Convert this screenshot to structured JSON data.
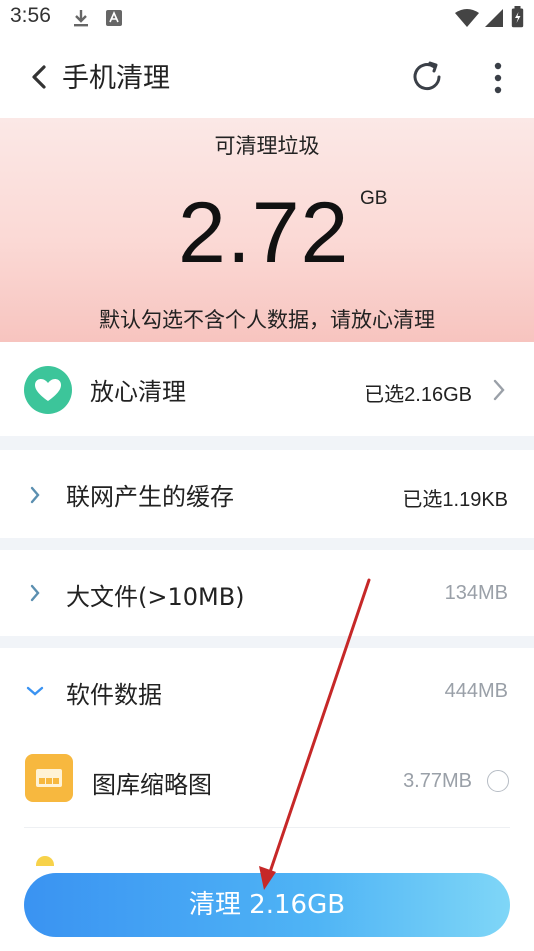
{
  "status_bar": {
    "time": "3:56",
    "icons": [
      "download-icon",
      "font-a-icon",
      "wifi-icon",
      "signal-icon",
      "battery-icon"
    ]
  },
  "app_bar": {
    "title": "手机清理",
    "icons": [
      "back-chevron-icon",
      "refresh-icon",
      "more-vert-icon"
    ]
  },
  "hero": {
    "label": "可清理垃圾",
    "value": "2.72",
    "unit": "GB",
    "note": "默认勾选不含个人数据，请放心清理"
  },
  "items": [
    {
      "id": "safe-clean",
      "label": "放心清理",
      "value": "已选2.16GB",
      "icon": "heart-shield-icon",
      "chevron": "right"
    },
    {
      "id": "network-cache",
      "label": "联网产生的缓存",
      "value": "已选1.19KB",
      "chevron": "right"
    },
    {
      "id": "large-files",
      "label": "大文件(>10MB)",
      "value": "134MB",
      "chevron": "right"
    },
    {
      "id": "app-data",
      "label": "软件数据",
      "value": "444MB",
      "chevron": "down"
    }
  ],
  "sub_items": [
    {
      "id": "gallery-thumbs",
      "label": "图库缩略图",
      "value": "3.77MB",
      "icon": "gallery-icon",
      "checked": false
    }
  ],
  "clean_button": {
    "label": "清理 2.16GB"
  },
  "colors": {
    "accent_green": "#3cc59a",
    "button_blue": "#3a93f2",
    "app_icon_orange": "#f7b83f",
    "annotation_red": "#c62828"
  }
}
